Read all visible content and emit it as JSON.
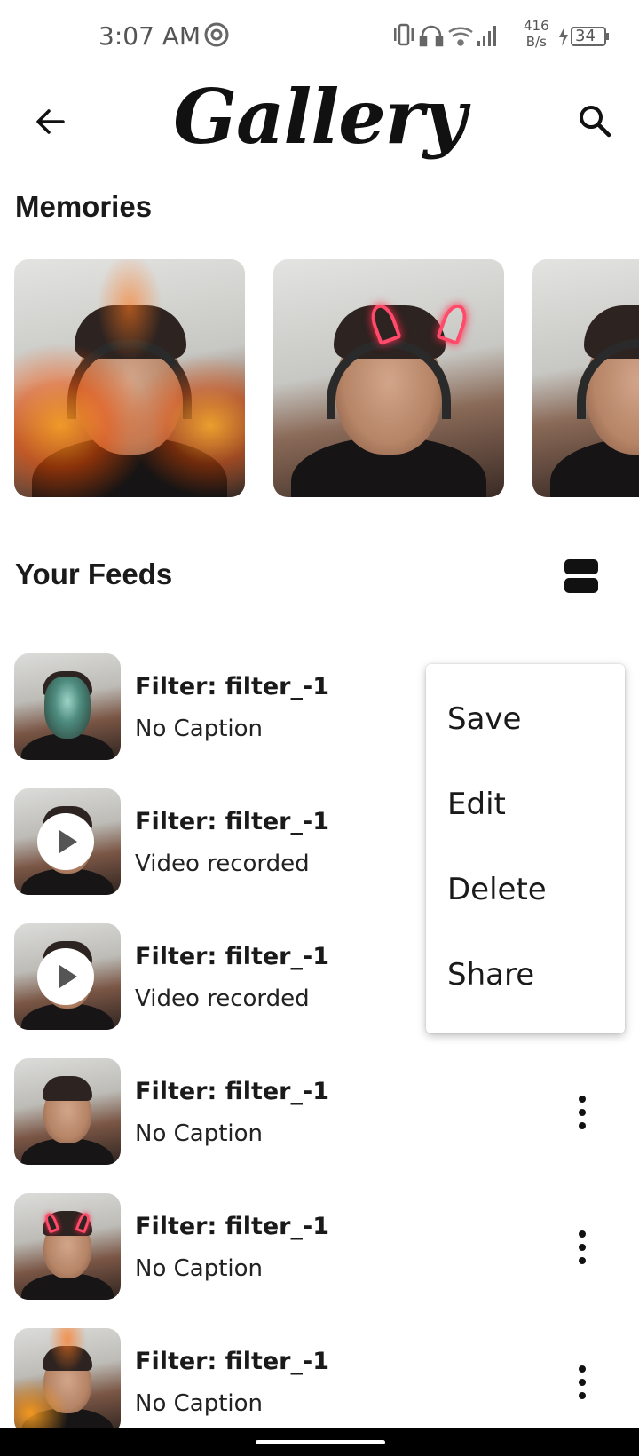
{
  "status_bar": {
    "time": "3:07 AM",
    "net_speed_value": "416",
    "net_speed_unit": "B/s",
    "battery": "34",
    "icons": [
      "at-sign-icon",
      "vibrate-icon",
      "headphones-battery-icon",
      "wifi-icon",
      "signal-icon",
      "charging-icon",
      "battery-icon"
    ]
  },
  "header": {
    "title": "Gallery",
    "back_icon": "arrow-left-icon",
    "search_icon": "search-icon"
  },
  "memories": {
    "title": "Memories",
    "items": [
      {
        "filter": "fire"
      },
      {
        "filter": "devil-horns"
      },
      {
        "filter": "plain"
      }
    ]
  },
  "feeds": {
    "title": "Your Feeds",
    "layout_icon": "view-agenda-icon",
    "items": [
      {
        "title": "Filter: filter_-1",
        "caption": "No Caption",
        "thumb": "mask",
        "video": false,
        "menu": false
      },
      {
        "title": "Filter: filter_-1",
        "caption": "Video recorded",
        "thumb": "plain",
        "video": true,
        "menu": false
      },
      {
        "title": "Filter: filter_-1",
        "caption": "Video recorded",
        "thumb": "plain",
        "video": true,
        "menu": false
      },
      {
        "title": "Filter: filter_-1",
        "caption": "No Caption",
        "thumb": "plain",
        "video": false,
        "menu": true
      },
      {
        "title": "Filter: filter_-1",
        "caption": "No Caption",
        "thumb": "horns",
        "video": false,
        "menu": true
      },
      {
        "title": "Filter: filter_-1",
        "caption": "No Caption",
        "thumb": "fire",
        "video": false,
        "menu": true
      }
    ]
  },
  "popup_menu": {
    "items": [
      "Save",
      "Edit",
      "Delete",
      "Share"
    ]
  }
}
